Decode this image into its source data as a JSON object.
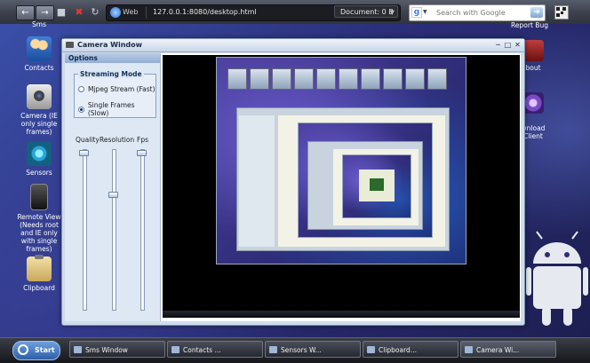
{
  "browser": {
    "address_scheme": "Web",
    "url": "127.0.0.1:8080/desktop.html",
    "document_label": "Document: 0 B",
    "search_placeholder": "Search with Google"
  },
  "desktop": {
    "icons_left": [
      {
        "name": "contacts",
        "label": "Contacts",
        "icon": "contacts-icon"
      },
      {
        "name": "camera",
        "label": "Camera (IE only single frames)",
        "icon": "camera-icon"
      },
      {
        "name": "sensors",
        "label": "Sensors",
        "icon": "sensors-icon"
      },
      {
        "name": "remote-view",
        "label": "Remote View (Needs root and IE only with single frames)",
        "icon": "phone-icon"
      },
      {
        "name": "clipboard",
        "label": "Clipboard",
        "icon": "clipboard-icon"
      }
    ],
    "icons_left_top_cut": "Sms",
    "icons_right": [
      {
        "name": "report-bug",
        "label": "Report Bug"
      },
      {
        "name": "about",
        "label": "About"
      },
      {
        "name": "download-client",
        "label": "Download Client"
      }
    ],
    "right_cut_labels": {
      "report": "Report Bug",
      "about": "bout",
      "download": "wnload\nClient"
    }
  },
  "camera_window": {
    "title": "Camera Window",
    "options_header": "Options",
    "streaming_mode_label": "Streaming Mode",
    "modes": [
      {
        "label": "Mjpeg Stream (Fast)",
        "checked": false
      },
      {
        "label": "Single Frames (Slow)",
        "checked": true
      }
    ],
    "sliders": [
      {
        "label": "Quality",
        "level": 1.0
      },
      {
        "label": "Resolution",
        "level": 0.73
      },
      {
        "label": "Fps",
        "level": 1.0
      }
    ]
  },
  "taskbar": {
    "start_label": "Start",
    "tasks": [
      "Sms Window",
      "Contacts ...",
      "Sensors W...",
      "Clipboard...",
      "Camera Wi..."
    ]
  }
}
